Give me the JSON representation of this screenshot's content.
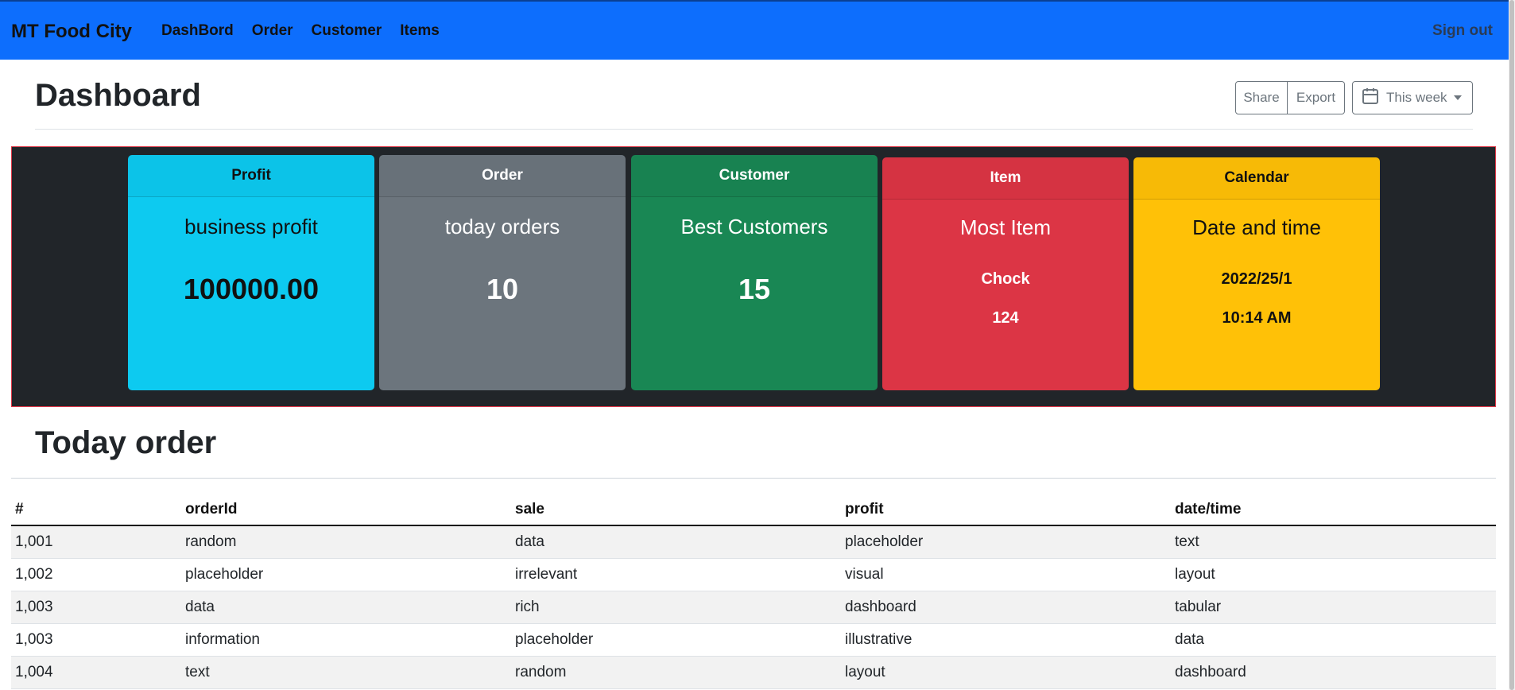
{
  "navbar": {
    "brand": "MT Food City",
    "links": [
      "DashBord",
      "Order",
      "Customer",
      "Items"
    ],
    "signout": "Sign out"
  },
  "header": {
    "title": "Dashboard",
    "share": "Share",
    "export": "Export",
    "range": "This week"
  },
  "cards": [
    {
      "header": "Profit",
      "title": "business profit",
      "value": "100000.00"
    },
    {
      "header": "Order",
      "title": "today orders",
      "value": "10"
    },
    {
      "header": "Customer",
      "title": "Best Customers",
      "value": "15"
    },
    {
      "header": "Item",
      "title": "Most Item",
      "line1": "Chock",
      "line2": "124"
    },
    {
      "header": "Calendar",
      "title": "Date and time",
      "line1": "2022/25/1",
      "line2": "10:14 AM"
    }
  ],
  "orders": {
    "title": "Today order",
    "columns": [
      "#",
      "orderId",
      "sale",
      "profit",
      "date/time"
    ],
    "rows": [
      [
        "1,001",
        "random",
        "data",
        "placeholder",
        "text"
      ],
      [
        "1,002",
        "placeholder",
        "irrelevant",
        "visual",
        "layout"
      ],
      [
        "1,003",
        "data",
        "rich",
        "dashboard",
        "tabular"
      ],
      [
        "1,003",
        "information",
        "placeholder",
        "illustrative",
        "data"
      ],
      [
        "1,004",
        "text",
        "random",
        "layout",
        "dashboard"
      ]
    ]
  },
  "colors": {
    "navbar": "#0d6efd",
    "profit": "#0dcaf0",
    "order": "#6c757d",
    "customer": "#198754",
    "item": "#dc3545",
    "calendar": "#ffc107"
  }
}
